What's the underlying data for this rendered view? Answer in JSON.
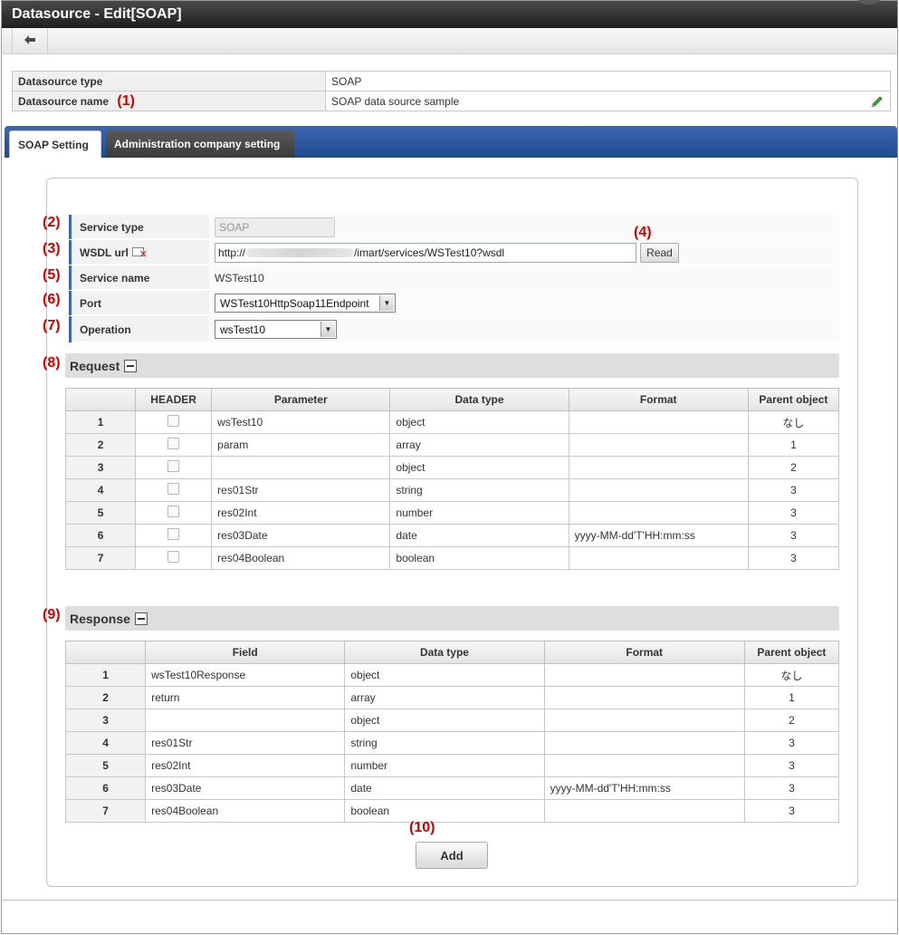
{
  "window": {
    "title": "Datasource - Edit[SOAP]"
  },
  "toolbar": {
    "back_icon": "back-arrow-icon",
    "back_glyph": "🡐"
  },
  "datasource": {
    "type_label": "Datasource type",
    "type_value": "SOAP",
    "name_label": "Datasource name",
    "name_value": "SOAP data source sample",
    "edit_icon": "pencil-icon"
  },
  "tabs": [
    {
      "label": "SOAP Setting",
      "active": true
    },
    {
      "label": "Administration company setting",
      "active": false
    }
  ],
  "form": {
    "service_type": {
      "label": "Service type",
      "value": "SOAP"
    },
    "wsdl_url": {
      "label": "WSDL url",
      "value_prefix": "http://",
      "value_suffix": "/imart/services/WSTest10?wsdl",
      "read_label": "Read"
    },
    "service_name": {
      "label": "Service name",
      "value": "WSTest10"
    },
    "port": {
      "label": "Port",
      "value": "WSTest10HttpSoap11Endpoint"
    },
    "operation": {
      "label": "Operation",
      "value": "wsTest10"
    }
  },
  "request": {
    "title": "Request",
    "columns": [
      "",
      "HEADER",
      "Parameter",
      "Data type",
      "Format",
      "Parent object"
    ],
    "rows": [
      {
        "idx": "1",
        "param": "wsTest10",
        "type": "object",
        "format": "",
        "parent": "なし"
      },
      {
        "idx": "2",
        "param": "param",
        "type": "array",
        "format": "",
        "parent": "1"
      },
      {
        "idx": "3",
        "param": "",
        "type": "object",
        "format": "",
        "parent": "2"
      },
      {
        "idx": "4",
        "param": "res01Str",
        "type": "string",
        "format": "",
        "parent": "3"
      },
      {
        "idx": "5",
        "param": "res02Int",
        "type": "number",
        "format": "",
        "parent": "3"
      },
      {
        "idx": "6",
        "param": "res03Date",
        "type": "date",
        "format": "yyyy-MM-dd'T'HH:mm:ss",
        "parent": "3"
      },
      {
        "idx": "7",
        "param": "res04Boolean",
        "type": "boolean",
        "format": "",
        "parent": "3"
      }
    ]
  },
  "response": {
    "title": "Response",
    "columns": [
      "",
      "Field",
      "Data type",
      "Format",
      "Parent object"
    ],
    "rows": [
      {
        "idx": "1",
        "field": "wsTest10Response",
        "type": "object",
        "format": "",
        "parent": "なし"
      },
      {
        "idx": "2",
        "field": "return",
        "type": "array",
        "format": "",
        "parent": "1"
      },
      {
        "idx": "3",
        "field": "",
        "type": "object",
        "format": "",
        "parent": "2"
      },
      {
        "idx": "4",
        "field": "res01Str",
        "type": "string",
        "format": "",
        "parent": "3"
      },
      {
        "idx": "5",
        "field": "res02Int",
        "type": "number",
        "format": "",
        "parent": "3"
      },
      {
        "idx": "6",
        "field": "res03Date",
        "type": "date",
        "format": "yyyy-MM-dd'T'HH:mm:ss",
        "parent": "3"
      },
      {
        "idx": "7",
        "field": "res04Boolean",
        "type": "boolean",
        "format": "",
        "parent": "3"
      }
    ]
  },
  "add_label": "Add",
  "annotations": [
    "(1)",
    "(2)",
    "(3)",
    "(4)",
    "(5)",
    "(6)",
    "(7)",
    "(8)",
    "(9)",
    "(10)"
  ],
  "colors": {
    "annotation": "#cc0000",
    "tabbar": "#2a559e",
    "label_accent": "#3d66b0"
  }
}
